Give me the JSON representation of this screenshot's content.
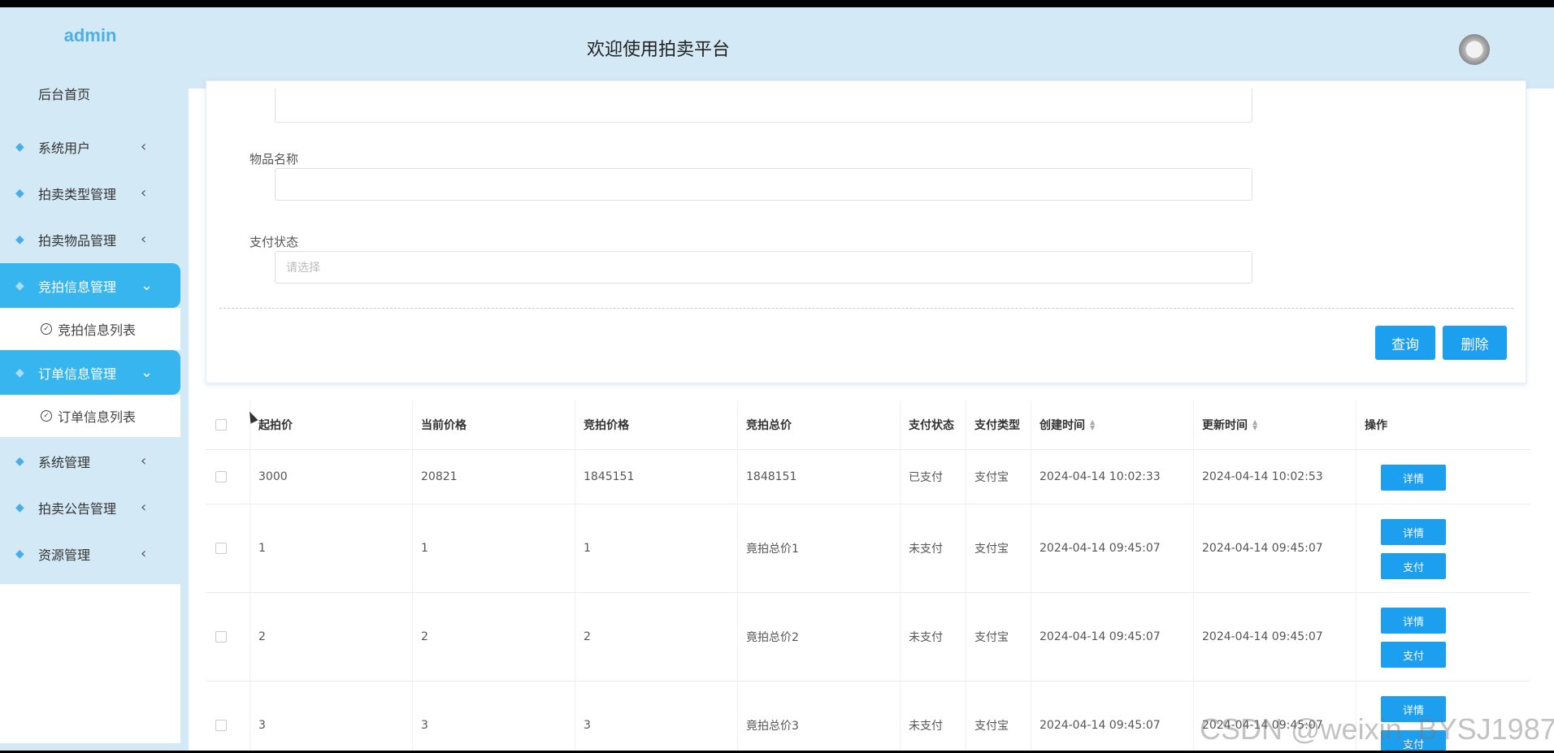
{
  "header": {
    "brand": "admin",
    "welcome": "欢迎使用拍卖平台"
  },
  "sidebar": {
    "home": "后台首页",
    "items": [
      {
        "label": "系统用户"
      },
      {
        "label": "拍卖类型管理"
      },
      {
        "label": "拍卖物品管理"
      },
      {
        "label": "竞拍信息管理",
        "sub": "竞拍信息列表"
      },
      {
        "label": "订单信息管理",
        "sub": "订单信息列表"
      },
      {
        "label": "系统管理"
      },
      {
        "label": "拍卖公告管理"
      },
      {
        "label": "资源管理"
      }
    ],
    "chevron_left": "‹",
    "chevron_down": "⌄"
  },
  "search": {
    "item_name_label": "物品名称",
    "item_name_value": "",
    "pay_status_label": "支付状态",
    "pay_status_placeholder": "请选择",
    "query_button": "查询",
    "delete_button": "删除"
  },
  "table": {
    "columns": [
      "起拍价",
      "当前价格",
      "竞拍价格",
      "竞拍总价",
      "支付状态",
      "支付类型",
      "创建时间",
      "更新时间",
      "操作"
    ],
    "rows": [
      {
        "start": "3000",
        "current": "20821",
        "bid": "1845151",
        "total": "1848151",
        "status": "已支付",
        "type": "支付宝",
        "created": "2024-04-14 10:02:33",
        "updated": "2024-04-14 10:02:53",
        "actions": [
          "详情"
        ]
      },
      {
        "start": "1",
        "current": "1",
        "bid": "1",
        "total": "竟拍总价1",
        "status": "未支付",
        "type": "支付宝",
        "created": "2024-04-14 09:45:07",
        "updated": "2024-04-14 09:45:07",
        "actions": [
          "详情",
          "支付"
        ]
      },
      {
        "start": "2",
        "current": "2",
        "bid": "2",
        "total": "竟拍总价2",
        "status": "未支付",
        "type": "支付宝",
        "created": "2024-04-14 09:45:07",
        "updated": "2024-04-14 09:45:07",
        "actions": [
          "详情",
          "支付"
        ]
      },
      {
        "start": "3",
        "current": "3",
        "bid": "3",
        "total": "竟拍总价3",
        "status": "未支付",
        "type": "支付宝",
        "created": "2024-04-14 09:45:07",
        "updated": "2024-04-14 09:45:07",
        "actions": [
          "详情",
          "支付"
        ]
      }
    ]
  },
  "watermark": "CSDN @weixin_BYSJ1987",
  "colors": {
    "accent": "#1d9ff0",
    "sidebar_active": "#36b5ef",
    "background": "#d4e9f6"
  }
}
